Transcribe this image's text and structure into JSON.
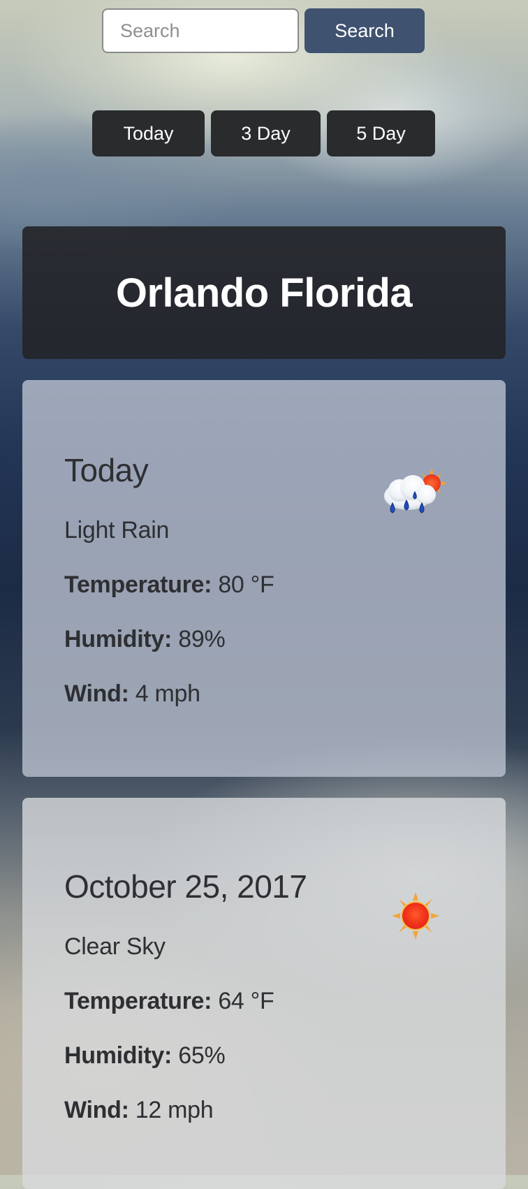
{
  "search": {
    "placeholder": "Search",
    "value": "",
    "button_label": "Search"
  },
  "tabs": [
    {
      "label": "Today"
    },
    {
      "label": "3 Day"
    },
    {
      "label": "5 Day"
    }
  ],
  "location": {
    "title": "Orlando Florida"
  },
  "cards": [
    {
      "day": "Today",
      "condition": "Light Rain",
      "temperature_label": "Temperature:",
      "temperature_value": " 80 °F",
      "humidity_label": "Humidity:",
      "humidity_value": " 89%",
      "wind_label": "Wind:",
      "wind_value": " 4 mph",
      "icon": "rain-with-sun-icon"
    },
    {
      "day": "October 25, 2017",
      "condition": "Clear Sky",
      "temperature_label": "Temperature:",
      "temperature_value": " 64 °F",
      "humidity_label": "Humidity:",
      "humidity_value": " 65%",
      "wind_label": "Wind:",
      "wind_value": " 12 mph",
      "icon": "sun-icon"
    }
  ],
  "colors": {
    "search_button": "#3f5270",
    "tab_background": "#2a2b2d",
    "city_card": "#242529",
    "text_dark": "#2e2f33"
  }
}
